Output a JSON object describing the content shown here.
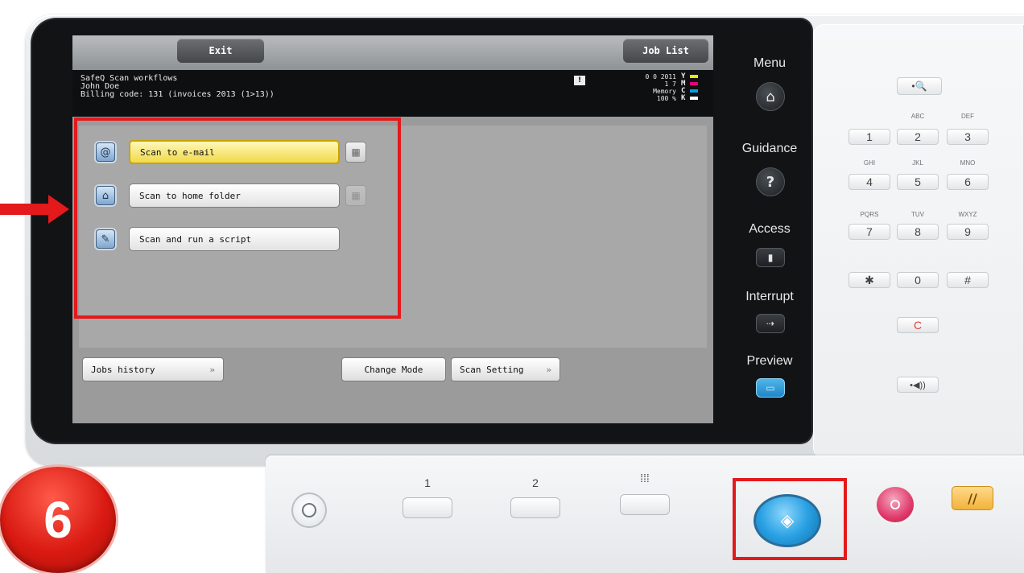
{
  "screen": {
    "top_tabs": {
      "exit": "Exit",
      "job_list": "Job List"
    },
    "info": {
      "workflow_title": "SafeQ Scan workflows",
      "user_name": "John Doe",
      "billing_code": "Billing code: 131 (invoices 2013 (1>13))"
    },
    "status": {
      "warning_icon": "alert-icon",
      "counter_line": "0 0 2011",
      "counter_line2": "1 7",
      "memory_label": "Memory",
      "memory_value": "100 %",
      "toner_letters": [
        "Y",
        "M",
        "C",
        "K"
      ],
      "toner_colors": [
        "#f2e600",
        "#e6007e",
        "#00a0e9",
        "#ffffff"
      ]
    },
    "workflows": [
      {
        "label": "Scan to e-mail",
        "icon": "email-at-icon",
        "glyph": "@",
        "selected": true,
        "side_icon": "calendar-icon",
        "side_disabled": false
      },
      {
        "label": "Scan to home folder",
        "icon": "home-folder-icon",
        "glyph": "⌂",
        "selected": false,
        "side_icon": "calendar-icon",
        "side_disabled": true
      },
      {
        "label": "Scan and run a script",
        "icon": "script-icon",
        "glyph": "✎",
        "selected": false
      }
    ],
    "bottom": {
      "jobs_history": "Jobs history",
      "change_mode": "Change Mode",
      "scan_setting": "Scan Setting",
      "arrow_glyph": "»"
    }
  },
  "side_menu": {
    "items": [
      {
        "label": "Menu",
        "icon": "home-icon",
        "glyph": "⌂"
      },
      {
        "label": "Guidance",
        "icon": "question-icon",
        "glyph": "?"
      },
      {
        "label": "Access",
        "icon": "access-door-icon",
        "glyph": "▮"
      },
      {
        "label": "Interrupt",
        "icon": "interrupt-icon",
        "glyph": "⇢"
      },
      {
        "label": "Preview",
        "icon": "preview-icon",
        "glyph": "▭"
      }
    ]
  },
  "keypad": {
    "zoom_icon": "zoom-icon",
    "zoom_glyph": "•🔍",
    "keys": [
      {
        "digit": "1",
        "letters": ""
      },
      {
        "digit": "2",
        "letters": "ABC"
      },
      {
        "digit": "3",
        "letters": "DEF"
      },
      {
        "digit": "4",
        "letters": "GHI"
      },
      {
        "digit": "5",
        "letters": "JKL"
      },
      {
        "digit": "6",
        "letters": "MNO"
      },
      {
        "digit": "7",
        "letters": "PQRS"
      },
      {
        "digit": "8",
        "letters": "TUV"
      },
      {
        "digit": "9",
        "letters": "WXYZ"
      },
      {
        "digit": "✱",
        "letters": ""
      },
      {
        "digit": "0",
        "letters": ""
      },
      {
        "digit": "#",
        "letters": ""
      }
    ],
    "clear_label": "C",
    "sound_label": "•◀))"
  },
  "lower_controls": {
    "function_keys": [
      "1",
      "2",
      "⁞⁞⁞"
    ],
    "power_icon": "power-save-icon",
    "start_icon": "start-icon",
    "stop_icon": "stop-icon",
    "reset_icon": "reset-icon"
  },
  "annotation": {
    "step_number": "6",
    "highlight_color": "#e3191c"
  }
}
